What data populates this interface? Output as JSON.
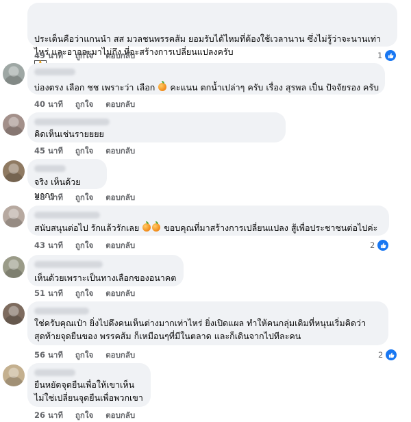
{
  "labels": {
    "like": "ถูกใจ",
    "reply": "ตอบกลับ"
  },
  "colors": {
    "bubble": "#f0f2f5",
    "meta": "#65676b",
    "like": "#1877f2"
  },
  "comments": [
    {
      "text": "ประเด็นคือว่าแกนนำ สส มวลชนพรรคส้ม ยอมรับได้ไหมที่ต้องใช้เวลานาน ซึ่งไม่รู้ว่าจะนานเท่าไหร่ และอาจจะมาไม่ถึง ที่จะสร้างการเปลี่ยนแปลงครับ",
      "emoji": "🙏",
      "time": "49 นาที",
      "reactions": "1"
    },
    {
      "text_before": "บ่องตรง เลือก ชช เพราะว่า เลือก",
      "text_after": "คะแนน ตกน้ำเปล่าๆ ครับ เรื่อง สุรพล เป็น ปัจจัยรอง ครับ",
      "time": "40 นาที"
    },
    {
      "text": "คิดเห็นเช่นรายยยย",
      "time": "45 นาที"
    },
    {
      "text": "จริง เห็นด้วยมากๆ",
      "time": "18 นาที"
    },
    {
      "text_before": "สนับสนุนต่อไป รักแล้วรักเลย",
      "text_after": "ขอบคุณที่มาสร้างการเปลี่ยนแปลง สู้เพื่อประชาชนต่อไปค่ะ",
      "time": "43 นาที",
      "reactions": "2"
    },
    {
      "text": "เห็นด้วยเพราะเป็นทางเลือกของอนาคต",
      "time": "51 นาที"
    },
    {
      "text": "ใช่ครับคุณเป๋า ยิ่งไปดึงคนเห็นต่างมากเท่าไหร่ ยิ่งเปิดแผล ทำให้คนกลุ่มเดิมที่หนุนเริ่มคิดว่าสุดท้ายจุดยืนของ พรรคส้ม ก็เหมือนๆที่มีในตลาด และก็เดินจากไปทีละคน",
      "time": "56 นาที",
      "reactions": "2"
    },
    {
      "text": "ยืนหยัดจุดยืนเพื่อให้เขาเห็น\nไม่ใช่เปลี่ยนจุดยืนเพื่อพวกเขา",
      "time": "26 นาที"
    }
  ]
}
